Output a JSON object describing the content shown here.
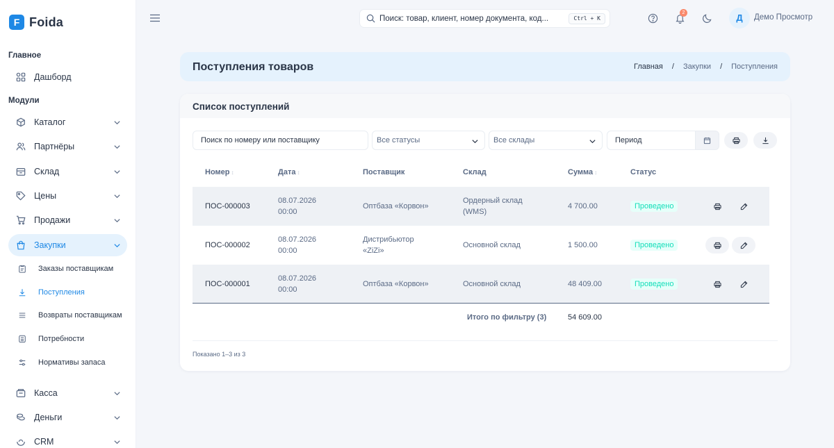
{
  "app": {
    "name": "Foida",
    "logo_letter": "F",
    "accent": "#1e88e5"
  },
  "sidebar": {
    "section_main": "Главное",
    "section_modules": "Модули",
    "items": [
      {
        "label": "Дашборд",
        "icon": "dashboard-icon"
      },
      {
        "label": "Каталог",
        "icon": "cube-icon"
      },
      {
        "label": "Партнёры",
        "icon": "users-icon"
      },
      {
        "label": "Склад",
        "icon": "box-icon"
      },
      {
        "label": "Цены",
        "icon": "tag-icon"
      },
      {
        "label": "Продажи",
        "icon": "cart-icon"
      },
      {
        "label": "Закупки",
        "icon": "bag-icon",
        "active": true
      },
      {
        "label": "Касса",
        "icon": "register-icon"
      },
      {
        "label": "Деньги",
        "icon": "coins-icon"
      },
      {
        "label": "CRM",
        "icon": "crm-icon"
      }
    ],
    "sub_items": [
      {
        "label": "Заказы поставщикам",
        "icon": "clipboard-icon"
      },
      {
        "label": "Поступления",
        "icon": "download-icon",
        "active": true
      },
      {
        "label": "Возвраты поставщикам",
        "icon": "list-icon"
      },
      {
        "label": "Потребности",
        "icon": "calculator-icon"
      },
      {
        "label": "Нормативы запаса",
        "icon": "sliders-icon"
      }
    ]
  },
  "header": {
    "search_placeholder": "Поиск: товар, клиент, номер документа, код...",
    "search_shortcut": "Ctrl + K",
    "notifications_count": "2",
    "avatar_letter": "Д",
    "user_name": "Демо Просмотр"
  },
  "page": {
    "title": "Поступления товаров",
    "breadcrumbs": [
      "Главная",
      "Закупки",
      "Поступления"
    ]
  },
  "list": {
    "title": "Список поступлений",
    "filters": {
      "search_placeholder": "Поиск по номеру или поставщику",
      "status_select": "Все статусы",
      "warehouse_select": "Все склады",
      "period_placeholder": "Период"
    },
    "columns": [
      "Номер",
      "Дата",
      "Поставщик",
      "Склад",
      "Сумма",
      "Статус"
    ],
    "rows": [
      {
        "number": "ПОС-000003",
        "date": "08.07.2026",
        "time": "00:00",
        "supplier": "Оптбаза «Корвон»",
        "warehouse": "Ордерный склад (WMS)",
        "sum": "4 700.00",
        "status": "Проведено"
      },
      {
        "number": "ПОС-000002",
        "date": "08.07.2026",
        "time": "00:00",
        "supplier": "Дистрибьютор «ZiZi»",
        "warehouse": "Основной склад",
        "sum": "1 500.00",
        "status": "Проведено"
      },
      {
        "number": "ПОС-000001",
        "date": "08.07.2026",
        "time": "00:00",
        "supplier": "Оптбаза «Корвон»",
        "warehouse": "Основной склад",
        "sum": "48 409.00",
        "status": "Проведено"
      }
    ],
    "total_label": "Итого по фильтру (3)",
    "total_value": "54 609.00",
    "shown_text": "Показано 1–3 из 3"
  }
}
